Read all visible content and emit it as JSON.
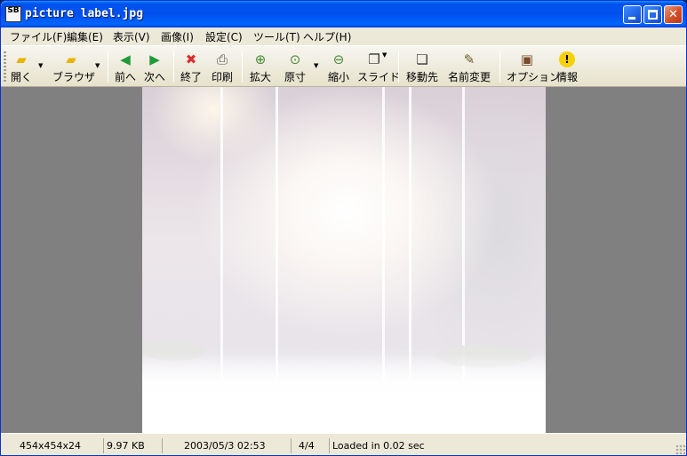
{
  "window": {
    "title": "picture label.jpg",
    "app_icon_text": "SB",
    "controls": {
      "minimize": "minimize",
      "maximize": "maximize",
      "close": "✕"
    }
  },
  "menu": [
    "ファイル(F)",
    "編集(E)",
    "表示(V)",
    "画像(I)",
    "設定(C)",
    "ツール(T)",
    "ヘルプ(H)"
  ],
  "toolbar": {
    "open": {
      "label": "開く",
      "icon": "folder-icon"
    },
    "browse": {
      "label": "ブラウザ",
      "icon": "browser-folder-icon"
    },
    "prev": {
      "label": "前へ",
      "icon": "arrow-left-icon"
    },
    "next": {
      "label": "次へ",
      "icon": "arrow-right-icon"
    },
    "exit": {
      "label": "終了",
      "icon": "x-icon"
    },
    "print": {
      "label": "印刷",
      "icon": "printer-icon"
    },
    "zoom_in": {
      "label": "拡大",
      "icon": "zoom-in-icon"
    },
    "actual": {
      "label": "原寸",
      "icon": "actual-size-icon"
    },
    "zoom_out": {
      "label": "縮小",
      "icon": "zoom-out-icon"
    },
    "slide": {
      "label": "スライド",
      "icon": "slideshow-icon"
    },
    "move_to": {
      "label": "移動先",
      "icon": "move-icon"
    },
    "rename": {
      "label": "名前変更",
      "icon": "rename-icon"
    },
    "options": {
      "label": "オプション",
      "icon": "options-icon"
    },
    "info": {
      "label": "情報",
      "icon": "info-icon"
    }
  },
  "status": {
    "dimensions": "454x454x24",
    "file_size": "9.97 KB",
    "date": "2003/05/3 02:53",
    "index": "4/4",
    "load_time": "Loaded in 0.02 sec"
  },
  "colors": {
    "titlebar": "#0058ee",
    "viewer_bg": "#808080",
    "chrome": "#ece9d8"
  }
}
